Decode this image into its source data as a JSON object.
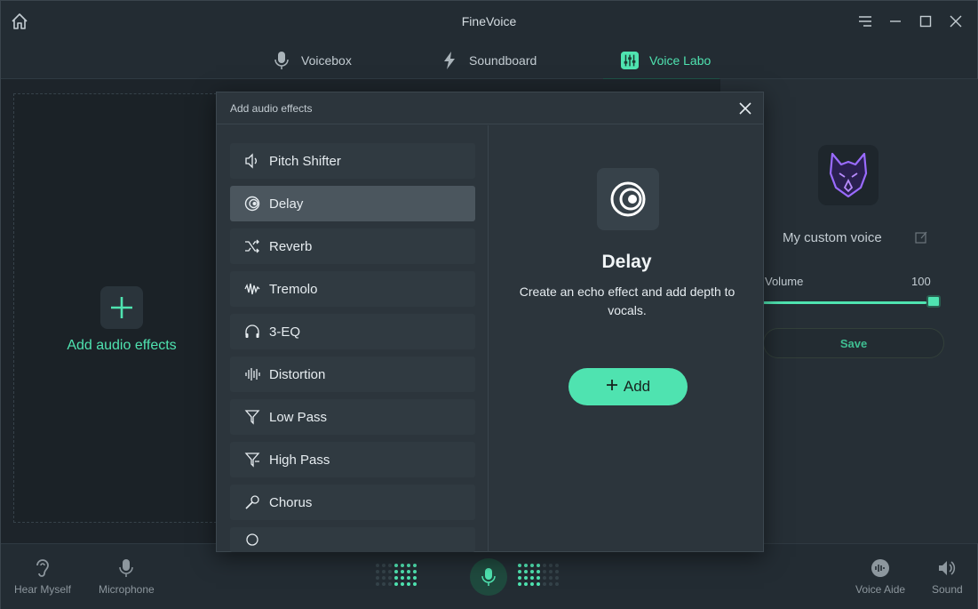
{
  "app": {
    "title": "FineVoice"
  },
  "tabs": [
    {
      "label": "Voicebox",
      "icon": "microphone-icon",
      "active": false
    },
    {
      "label": "Soundboard",
      "icon": "lightning-icon",
      "active": false
    },
    {
      "label": "Voice Labo",
      "icon": "sliders-icon",
      "active": true
    }
  ],
  "left_panel": {
    "add_label": "Add audio effects"
  },
  "right_panel": {
    "voice_name": "My custom voice",
    "volume_label": "Volume",
    "volume_value": "100",
    "volume_level": 1.0,
    "save_label": "Save"
  },
  "modal": {
    "title": "Add audio effects",
    "effects": [
      {
        "label": "Pitch Shifter",
        "icon": "speaker-icon"
      },
      {
        "label": "Delay",
        "icon": "echo-icon"
      },
      {
        "label": "Reverb",
        "icon": "shuffle-icon"
      },
      {
        "label": "Tremolo",
        "icon": "wave-icon"
      },
      {
        "label": "3-EQ",
        "icon": "headphones-icon"
      },
      {
        "label": "Distortion",
        "icon": "bars-icon"
      },
      {
        "label": "Low Pass",
        "icon": "filter-icon"
      },
      {
        "label": "High Pass",
        "icon": "filter-icon"
      },
      {
        "label": "Chorus",
        "icon": "microphone-icon"
      }
    ],
    "selected_index": 1,
    "detail": {
      "name": "Delay",
      "description": "Create an echo effect and add depth to vocals.",
      "add_label": "Add"
    }
  },
  "bottom_bar": {
    "hear_myself": "Hear Myself",
    "microphone": "Microphone",
    "voice_aide": "Voice Aide",
    "sound": "Sound"
  },
  "colors": {
    "accent": "#4fe3b0",
    "background": "#1d242a",
    "modal": "#2c353c"
  }
}
